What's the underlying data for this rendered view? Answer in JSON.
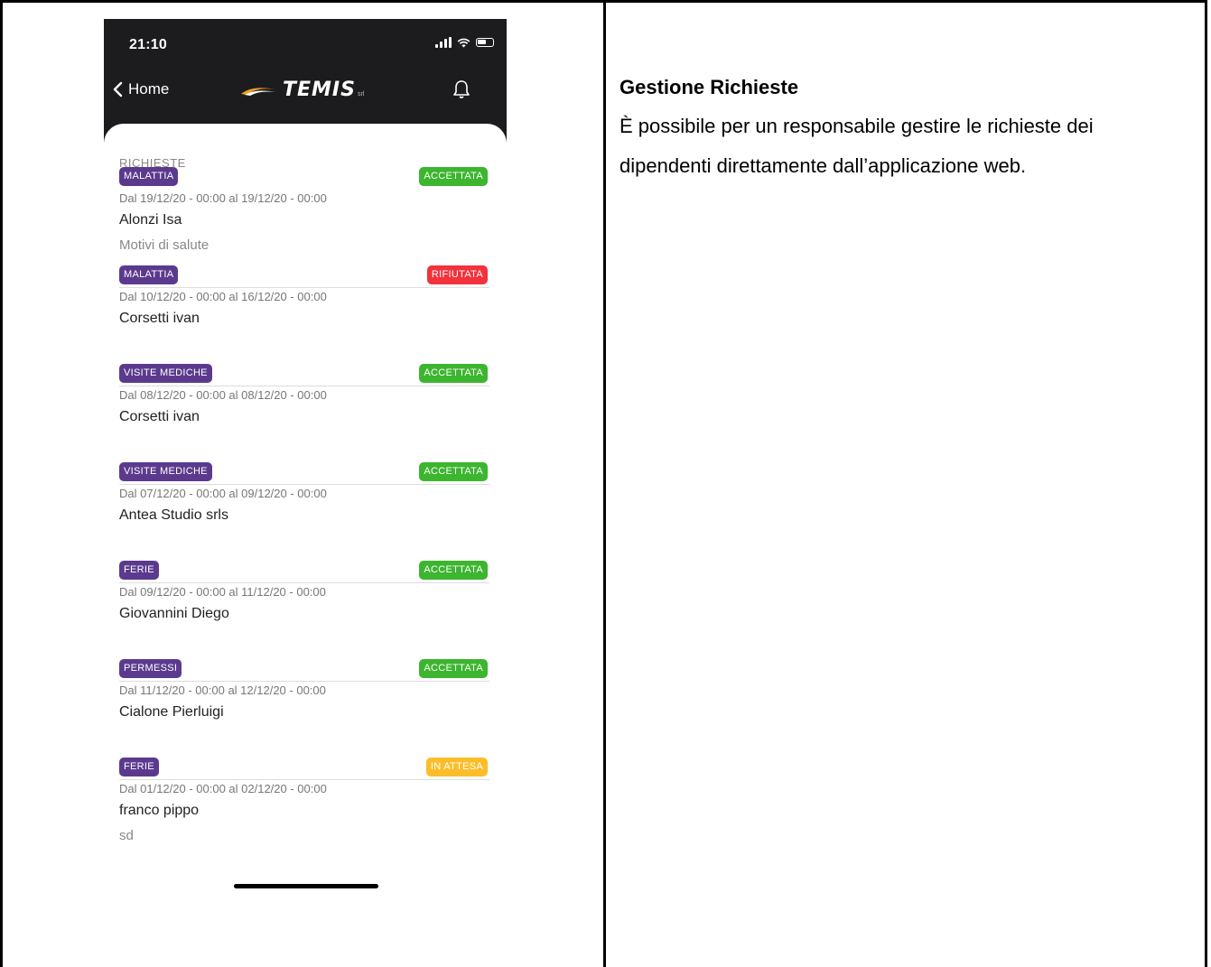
{
  "status_bar": {
    "time": "21:10"
  },
  "header": {
    "back_label": "Home",
    "logo_text": "TEMIS",
    "logo_suffix": "srl"
  },
  "section_title": "RICHIESTE",
  "requests": [
    {
      "type": "MALATTIA",
      "status": "ACCETTATA",
      "status_color": "#3cb52f",
      "dates": "Dal 19/12/20 - 00:00 al 19/12/20 - 00:00",
      "name": "Alonzi Isa",
      "reason": "Motivi di salute"
    },
    {
      "type": "MALATTIA",
      "status": "RIFIUTATA",
      "status_color": "#f2323c",
      "dates": "Dal 10/12/20 - 00:00 al 16/12/20 - 00:00",
      "name": "Corsetti ivan",
      "reason": ""
    },
    {
      "type": "VISITE MEDICHE",
      "status": "ACCETTATA",
      "status_color": "#3cb52f",
      "dates": "Dal 08/12/20 - 00:00 al 08/12/20 - 00:00",
      "name": "Corsetti ivan",
      "reason": ""
    },
    {
      "type": "VISITE MEDICHE",
      "status": "ACCETTATA",
      "status_color": "#3cb52f",
      "dates": "Dal 07/12/20 - 00:00 al 09/12/20 - 00:00",
      "name": "Antea Studio srls",
      "reason": ""
    },
    {
      "type": "FERIE",
      "status": "ACCETTATA",
      "status_color": "#3cb52f",
      "dates": "Dal 09/12/20 - 00:00 al 11/12/20 - 00:00",
      "name": "Giovannini Diego",
      "reason": ""
    },
    {
      "type": "PERMESSI",
      "status": "ACCETTATA",
      "status_color": "#3cb52f",
      "dates": "Dal 11/12/20 - 00:00 al 12/12/20 - 00:00",
      "name": "Cialone Pierluigi",
      "reason": ""
    },
    {
      "type": "FERIE",
      "status": "IN ATTESA",
      "status_color": "#fbbd29",
      "dates": "Dal 01/12/20 - 00:00 al 02/12/20 - 00:00",
      "name": "franco pippo",
      "reason": "sd"
    }
  ],
  "description": {
    "title": "Gestione Richieste",
    "body": "È possibile per un responsabile gestire le richieste dei dipendenti direttamente dall’applicazione web."
  },
  "colors": {
    "type_badge": "#5b3a8e",
    "header_bg": "#1c1c1e"
  }
}
